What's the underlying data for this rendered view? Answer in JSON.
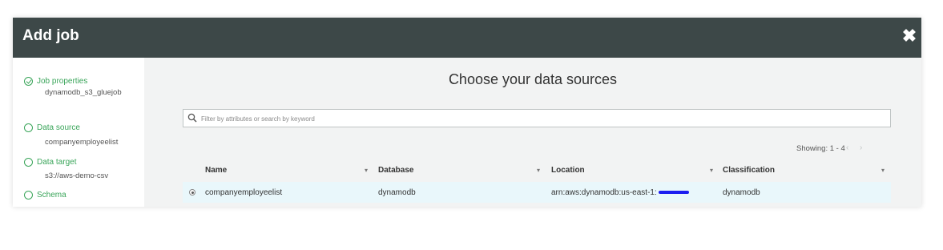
{
  "modal": {
    "title": "Add job",
    "close_symbol": "✖"
  },
  "sidebar": {
    "steps": [
      {
        "label": "Job properties",
        "value": "dynamodb_s3_gluejob",
        "status": "complete"
      },
      {
        "label": "Data source",
        "value": "companyemployeelist",
        "status": "pending"
      },
      {
        "label": "Data target",
        "value": "s3://aws-demo-csv",
        "status": "pending"
      },
      {
        "label": "Schema",
        "value": "",
        "status": "pending"
      }
    ]
  },
  "main": {
    "title": "Choose your data sources",
    "search": {
      "placeholder": "Filter by attributes or search by keyword",
      "value": ""
    },
    "pagination": {
      "showing": "Showing: 1 - 4",
      "prev": "‹",
      "next": "›"
    },
    "table": {
      "columns": [
        "Name",
        "Database",
        "Location",
        "Classification"
      ],
      "sort_symbol": "▾",
      "rows": [
        {
          "name": "companyemployeelist",
          "database": "dynamodb",
          "location": "arn:aws:dynamodb:us-east-1:",
          "classification": "dynamodb",
          "selected": true
        }
      ]
    }
  },
  "colors": {
    "header_bg": "#3d4848",
    "accent_green": "#3aa55a",
    "content_bg": "#f2f3f3",
    "selected_row_bg": "#e9f7fb",
    "redaction": "#1d1df0"
  }
}
